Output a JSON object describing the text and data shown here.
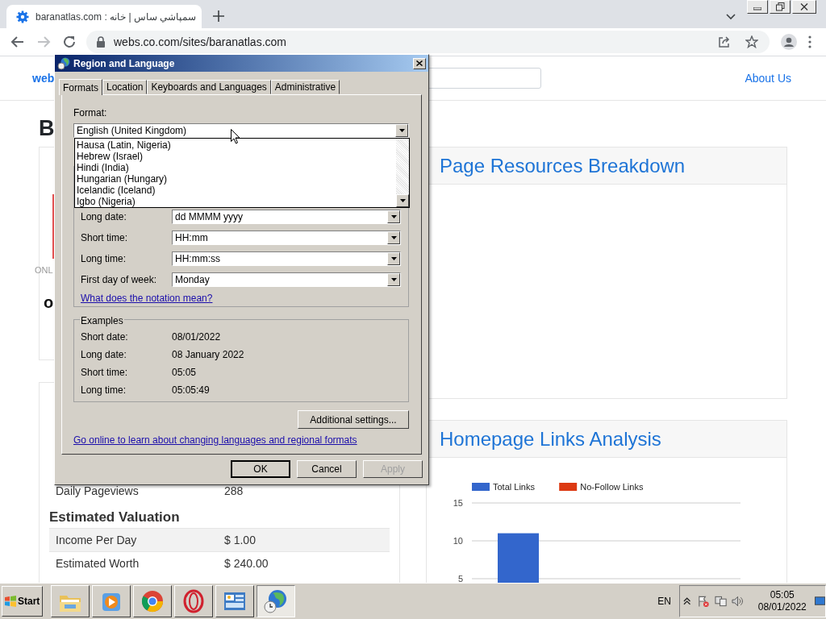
{
  "browser": {
    "tab": {
      "title": "baranatlas.com : سمپاشي ساس | خانه"
    },
    "forward_enabled": false,
    "url": "webs.co.com/sites/baranatlas.com"
  },
  "page": {
    "header": {
      "logo": "web",
      "nav_link": "About Us"
    },
    "title": "B",
    "overview": {
      "status_text": "ONL",
      "subtitle": "o"
    },
    "traffic": {
      "rows": [
        {
          "label": "Daily Pageviews",
          "value": "288"
        }
      ]
    },
    "valuation": {
      "title": "Estimated Valuation",
      "rows": [
        {
          "label": "Income Per Day",
          "value": "$ 1.00"
        },
        {
          "label": "Estimated Worth",
          "value": "$ 240.00"
        }
      ]
    },
    "resources": {
      "title": "Page Resources Breakdown"
    },
    "links": {
      "title": "Homepage Links Analysis",
      "chart_data": {
        "type": "bar",
        "series": [
          {
            "name": "Total Links",
            "color": "#3366cc",
            "values": [
              11
            ]
          },
          {
            "name": "No-Follow Links",
            "color": "#dc3912",
            "values": [
              null
            ]
          }
        ],
        "ylim": [
          0,
          15
        ],
        "yticks": [
          5,
          10,
          15
        ]
      }
    }
  },
  "dialog": {
    "title": "Region and Language",
    "tabs": [
      {
        "label": "Formats",
        "selected": true
      },
      {
        "label": "Location",
        "selected": false
      },
      {
        "label": "Keyboards and Languages",
        "selected": false
      },
      {
        "label": "Administrative",
        "selected": false
      }
    ],
    "format": {
      "label": "Format:",
      "value": "English (United Kingdom)",
      "list": [
        "Hausa (Latin, Nigeria)",
        "Hebrew (Israel)",
        "Hindi (India)",
        "Hungarian (Hungary)",
        "Icelandic (Iceland)",
        "Igbo (Nigeria)"
      ]
    },
    "date_formats": [
      {
        "label": "Long date:",
        "value": "dd MMMM yyyy"
      },
      {
        "label": "Short time:",
        "value": "HH:mm"
      },
      {
        "label": "Long time:",
        "value": "HH:mm:ss"
      },
      {
        "label": "First day of week:",
        "value": "Monday"
      }
    ],
    "notation_link": "What does the notation mean?",
    "examples": {
      "title": "Examples",
      "rows": [
        {
          "label": "Short date:",
          "value": "08/01/2022"
        },
        {
          "label": "Long date:",
          "value": "08 January 2022"
        },
        {
          "label": "Short time:",
          "value": "05:05"
        },
        {
          "label": "Long time:",
          "value": "05:05:49"
        }
      ]
    },
    "additional_button": "Additional settings...",
    "online_link": "Go online to learn about changing languages and regional formats",
    "buttons": [
      {
        "label": "OK",
        "default": true,
        "disabled": false
      },
      {
        "label": "Cancel",
        "default": false,
        "disabled": false
      },
      {
        "label": "Apply",
        "default": false,
        "disabled": true
      }
    ]
  },
  "taskbar": {
    "start_label": "Start",
    "apps": [
      {
        "kind": "folder",
        "selected": false
      },
      {
        "kind": "media",
        "selected": false
      },
      {
        "kind": "browser",
        "selected": false
      },
      {
        "kind": "ring",
        "selected": false
      },
      {
        "kind": "panel",
        "selected": false
      },
      {
        "kind": "globe",
        "selected": true
      }
    ],
    "language": "EN",
    "time": "05:05",
    "date": "08/01/2022"
  }
}
